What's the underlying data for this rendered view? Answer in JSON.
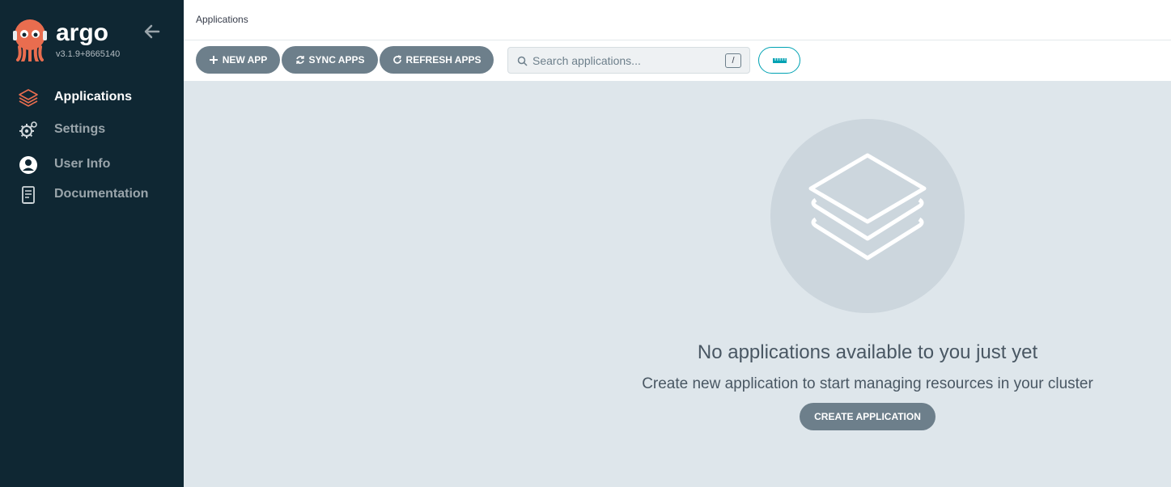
{
  "sidebar": {
    "brand": "argo",
    "version": "v3.1.9+8665140",
    "items": [
      {
        "label": "Applications",
        "icon": "layers-icon",
        "active": true
      },
      {
        "label": "Settings",
        "icon": "gears-icon",
        "active": false
      },
      {
        "label": "User Info",
        "icon": "user-circle-icon",
        "active": false
      },
      {
        "label": "Documentation",
        "icon": "book-icon",
        "active": false
      }
    ]
  },
  "header": {
    "breadcrumb": "Applications"
  },
  "toolbar": {
    "new_app": "NEW APP",
    "sync_apps": "SYNC APPS",
    "refresh_apps": "REFRESH APPS",
    "search_placeholder": "Search applications...",
    "search_shortcut": "/"
  },
  "empty_state": {
    "title": "No applications available to you just yet",
    "subtitle": "Create new application to start managing resources in your cluster",
    "button": "CREATE APPLICATION"
  },
  "colors": {
    "sidebar_bg": "#0f2733",
    "accent": "#e96d4f",
    "button_bg": "#6d7f8b",
    "teal": "#00a2b3",
    "content_bg": "#dee6eb"
  }
}
